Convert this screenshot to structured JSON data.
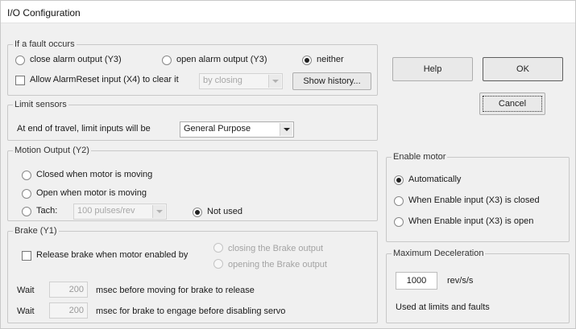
{
  "window": {
    "title": "I/O Configuration"
  },
  "fault": {
    "legend": "If a fault occurs",
    "options": [
      "close alarm output (Y3)",
      "open alarm output (Y3)",
      "neither"
    ],
    "selected": "neither",
    "allow_reset_label": "Allow AlarmReset input (X4) to clear it",
    "allow_reset_checked": false,
    "reset_mode_value": "by closing",
    "show_history_label": "Show history..."
  },
  "limit": {
    "legend": "Limit sensors",
    "prompt": "At end of travel, limit inputs will be",
    "value": "General Purpose"
  },
  "motion": {
    "legend": "Motion Output (Y2)",
    "options": [
      "Closed when motor is moving",
      "Open when motor is moving",
      "Tach:",
      "Not used"
    ],
    "selected": "Not used",
    "tach_value": "100 pulses/rev"
  },
  "brake": {
    "legend": "Brake (Y1)",
    "release_label": "Release brake when motor enabled by",
    "release_checked": false,
    "options": [
      "closing the Brake output",
      "opening the Brake output"
    ],
    "wait_label": "Wait",
    "wait1_value": "200",
    "wait1_suffix": "msec before moving for brake to release",
    "wait2_value": "200",
    "wait2_suffix": "msec for brake to engage before disabling servo"
  },
  "buttons": {
    "help": "Help",
    "ok": "OK",
    "cancel": "Cancel"
  },
  "enable": {
    "legend": "Enable motor",
    "options": [
      "Automatically",
      "When Enable input (X3) is closed",
      "When Enable input (X3) is open"
    ],
    "selected": "Automatically"
  },
  "decel": {
    "legend": "Maximum Deceleration",
    "value": "1000",
    "unit": "rev/s/s",
    "note": "Used at limits and faults"
  },
  "colors": {
    "face": "#f0f0f0",
    "border": "#c8c8c8",
    "disabled_text": "#a3a3a3"
  }
}
